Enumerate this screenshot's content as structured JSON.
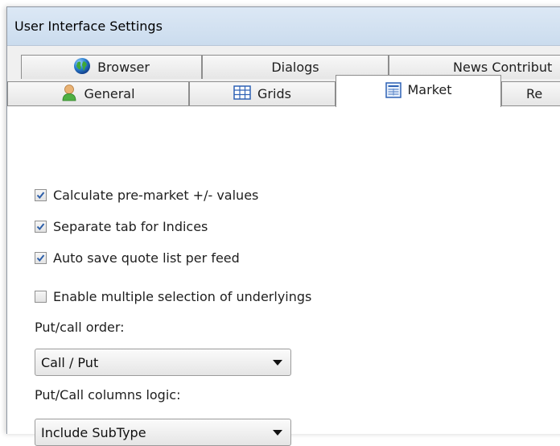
{
  "window": {
    "title": "User Interface Settings"
  },
  "tabs": {
    "back": [
      "Browser",
      "Dialogs",
      "News Contribut"
    ],
    "front": [
      "General",
      "Grids",
      "Market",
      "Re"
    ],
    "selected": "Market"
  },
  "market": {
    "checkboxes": [
      {
        "label": "Calculate pre-market +/- values",
        "checked": true
      },
      {
        "label": "Separate tab for Indices",
        "checked": true
      },
      {
        "label": "Auto save quote list per feed",
        "checked": true
      },
      {
        "label": "Enable multiple selection of underlyings",
        "checked": false
      }
    ],
    "put_call_order": {
      "label": "Put/call order:",
      "value": "Call / Put"
    },
    "put_call_columns": {
      "label": "Put/Call columns logic:",
      "value": "Include SubType"
    }
  }
}
